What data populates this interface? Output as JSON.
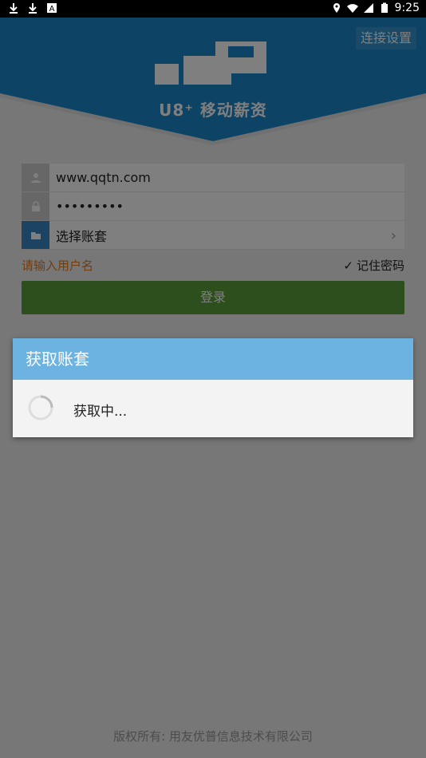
{
  "status_bar": {
    "left_icons": [
      "download-icon",
      "download-icon",
      "a-box-icon"
    ],
    "right_icons": [
      "location-icon",
      "wifi-icon",
      "signal-icon",
      "battery-icon"
    ],
    "time": "9:25"
  },
  "header": {
    "connect_settings": "连接设置",
    "logo_text": "U8⁺ 移动薪资",
    "background_color": "#1a86c8"
  },
  "form": {
    "username_value": "www.qqtn.com",
    "password_value": "•••••••••",
    "account_select_label": "选择账套",
    "hint": "请输入用户名",
    "remember_label": "记住密码",
    "login_label": "登录",
    "login_color": "#5a9e3a"
  },
  "dialog": {
    "title": "获取账套",
    "message": "获取中...",
    "title_color": "#6db3e2"
  },
  "footer": {
    "copyright": "版权所有: 用友优普信息技术有限公司"
  }
}
